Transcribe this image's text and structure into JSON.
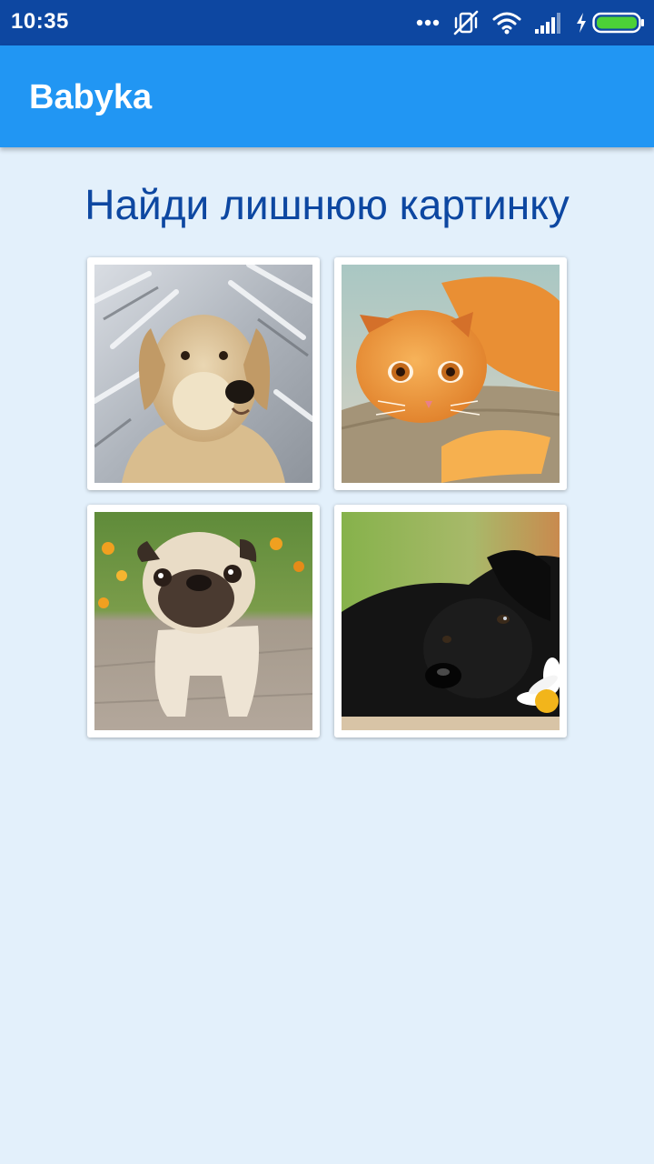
{
  "status_bar": {
    "time": "10:35",
    "icons": [
      "more-dots-icon",
      "vibrate-off-icon",
      "wifi-icon",
      "signal-icon",
      "charging-icon",
      "battery-icon"
    ]
  },
  "app_bar": {
    "title": "Babyka"
  },
  "game": {
    "prompt": "Найди лишнюю картинку",
    "pictures": [
      {
        "subject": "golden retriever in snow"
      },
      {
        "subject": "ginger scottish fold kitten"
      },
      {
        "subject": "pug on stone path"
      },
      {
        "subject": "black dog with daisy"
      }
    ]
  },
  "colors": {
    "status_bar": "#0d47a1",
    "app_bar": "#2196f3",
    "background": "#e3f0fb",
    "prompt_text": "#0d47a1"
  }
}
